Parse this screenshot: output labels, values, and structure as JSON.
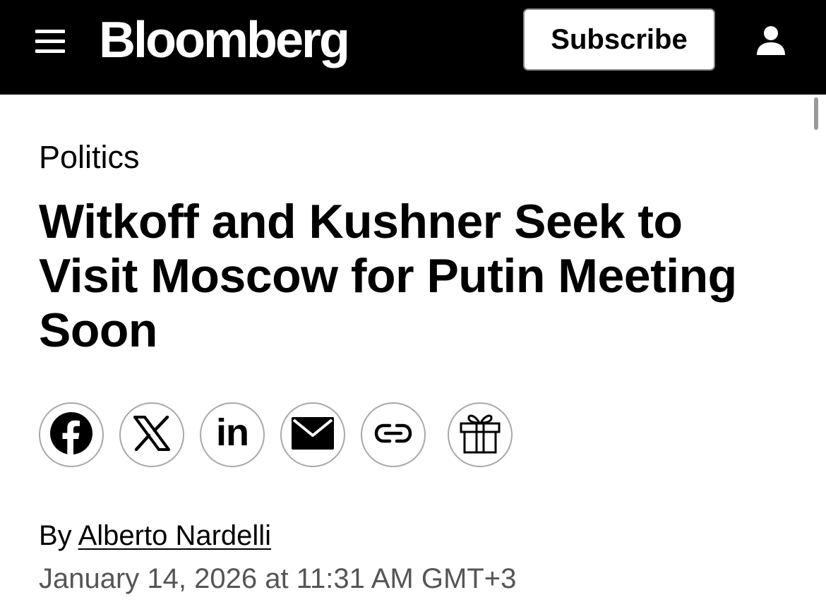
{
  "header": {
    "logo_text": "Bloomberg",
    "subscribe_label": "Subscribe",
    "menu_icon": "hamburger-menu-icon",
    "account_icon": "person-icon",
    "background": "#000000"
  },
  "article": {
    "section": "Politics",
    "headline": "Witkoff and Kushner Seek to Visit Moscow for Putin Meeting Soon",
    "byline_prefix": "By",
    "author": "Alberto Nardelli",
    "dateline": "January 14, 2026 at 11:31 AM GMT+3"
  },
  "share_buttons": [
    {
      "icon": "facebook-icon"
    },
    {
      "icon": "x-icon"
    },
    {
      "icon": "linkedin-icon",
      "text": "in"
    },
    {
      "icon": "email-icon"
    },
    {
      "icon": "link-icon"
    },
    {
      "icon": "gift-icon"
    }
  ]
}
